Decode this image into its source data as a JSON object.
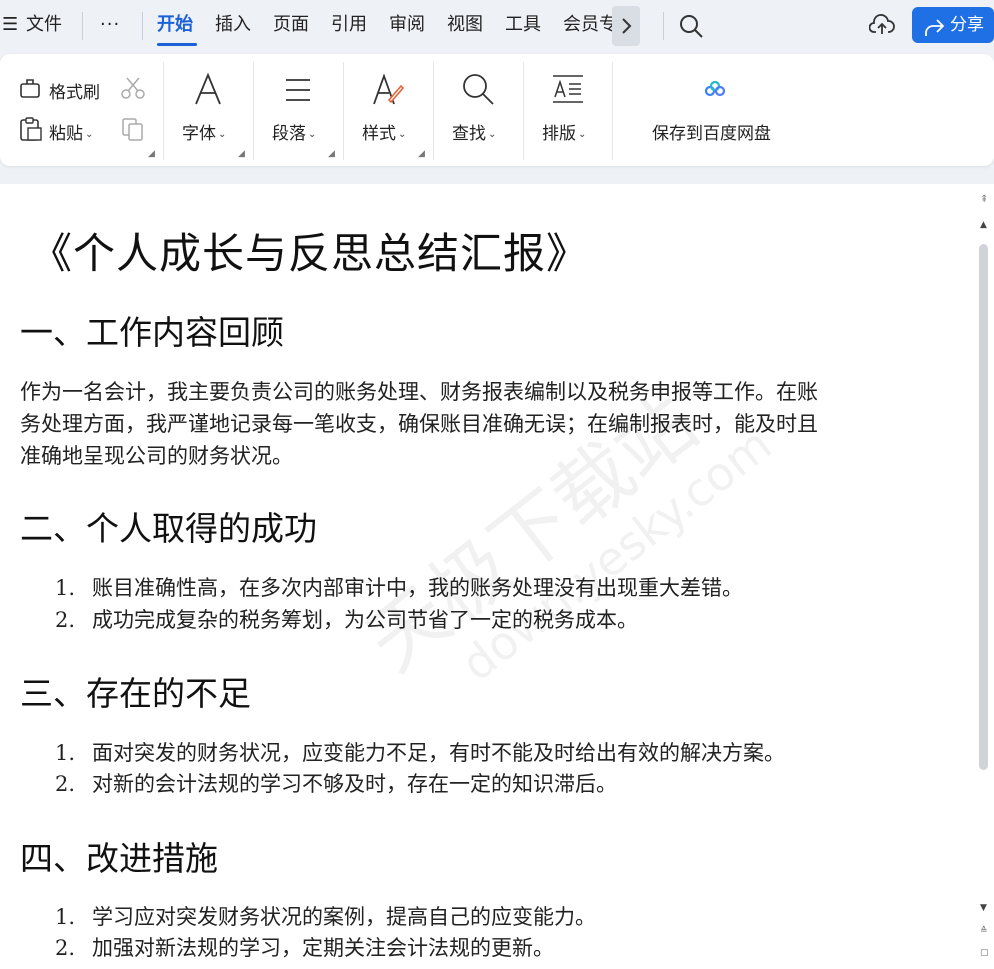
{
  "menubar": {
    "menu_icon": "hamburger-icon",
    "file_label": "文件",
    "more_label": "···",
    "tabs": [
      "开始",
      "插入",
      "页面",
      "引用",
      "审阅",
      "视图",
      "工具",
      "会员专"
    ],
    "active_tab": "开始",
    "next_icon": "chevron-right-icon",
    "search_icon": "search-icon",
    "cloud_icon": "cloud-upload-icon",
    "share_label": "分享",
    "accent_color": "#1a62d6"
  },
  "ribbon": {
    "format_painter": "格式刷",
    "paste": "粘贴",
    "font": "字体",
    "paragraph": "段落",
    "style": "样式",
    "find": "查找",
    "layout": "排版",
    "save_baidu": "保存到百度网盘"
  },
  "document": {
    "title": "《个人成长与反思总结汇报》",
    "sections": [
      {
        "heading": "一、工作内容回顾",
        "paragraph_lines": [
          "作为一名会计，我主要负责公司的账务处理、财务报表编制以及税务申报等工作。在账",
          "务处理方面，我严谨地记录每一笔收支，确保账目准确无误；在编制报表时，能及时且",
          "准确地呈现公司的财务状况。"
        ]
      },
      {
        "heading": "二、个人取得的成功",
        "items": [
          {
            "num": "1.",
            "text": "账目准确性高，在多次内部审计中，我的账务处理没有出现重大差错。"
          },
          {
            "num": "2.",
            "text": "成功完成复杂的税务筹划，为公司节省了一定的税务成本。"
          }
        ]
      },
      {
        "heading": "三、存在的不足",
        "items": [
          {
            "num": "1.",
            "text": "面对突发的财务状况，应变能力不足，有时不能及时给出有效的解决方案。"
          },
          {
            "num": "2.",
            "text": "对新的会计法规的学习不够及时，存在一定的知识滞后。"
          }
        ]
      },
      {
        "heading": "四、改进措施",
        "items": [
          {
            "num": "1.",
            "text": "学习应对突发财务状况的案例，提高自己的应变能力。"
          },
          {
            "num": "2.",
            "text": "加强对新法规的学习，定期关注会计法规的更新。"
          }
        ]
      }
    ],
    "watermark_line1": "天极下载站",
    "watermark_line2": "down.yesky.com"
  }
}
